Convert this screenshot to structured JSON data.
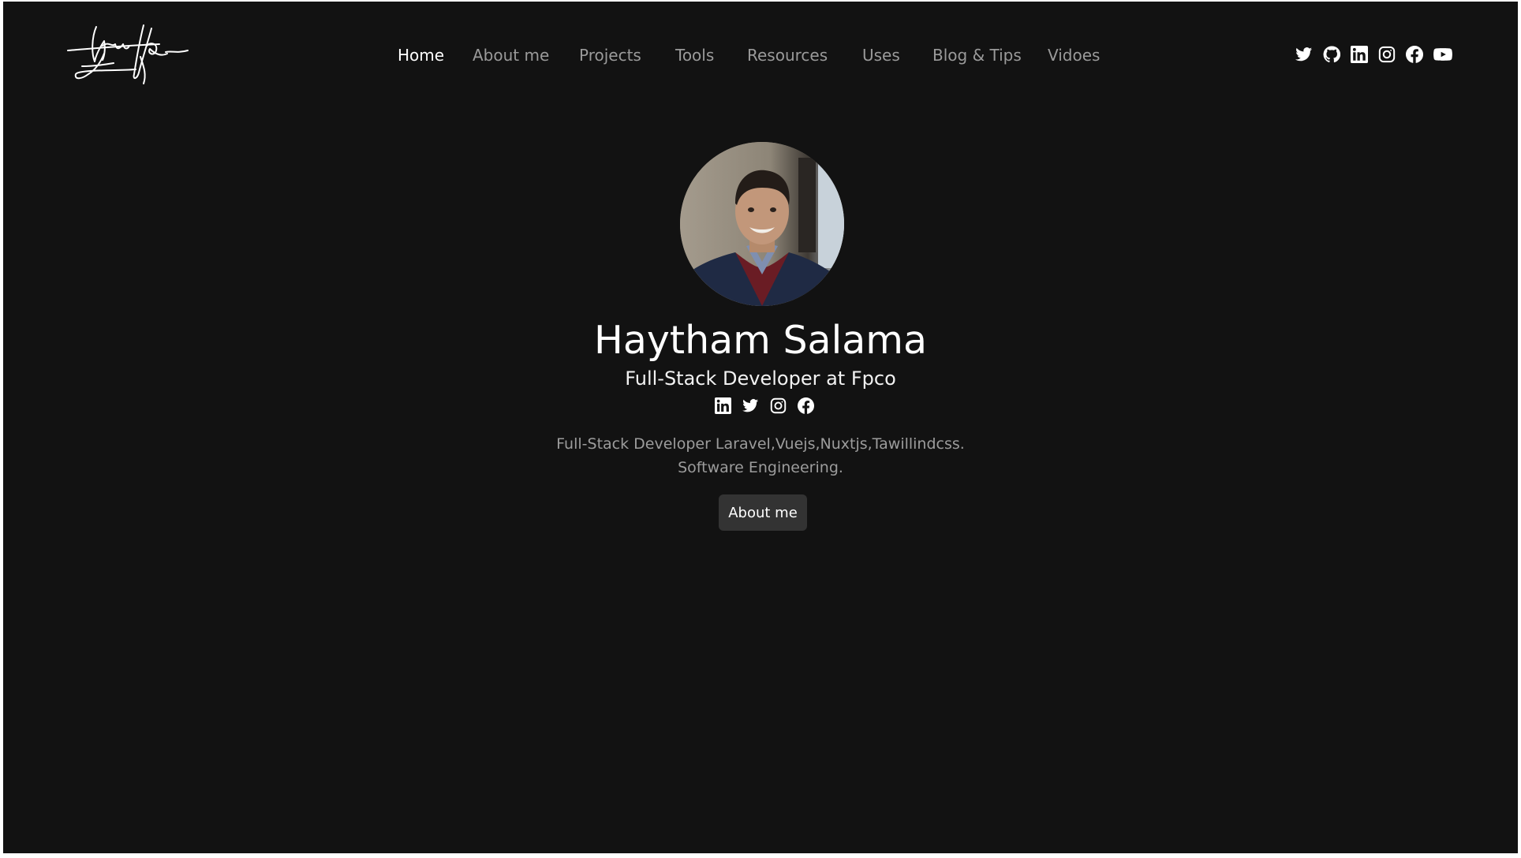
{
  "logo": {
    "alt": "Haytham signature"
  },
  "nav": {
    "items": [
      {
        "label": "Home",
        "active": true
      },
      {
        "label": "About me",
        "active": false
      },
      {
        "label": "Projects",
        "active": false
      },
      {
        "label": "Tools",
        "active": false
      },
      {
        "label": "Resources",
        "active": false
      },
      {
        "label": "Uses",
        "active": false
      },
      {
        "label": "Blog & Tips",
        "active": false
      },
      {
        "label": "Vidoes",
        "active": false
      }
    ],
    "social_icons": [
      "twitter-icon",
      "github-icon",
      "linkedin-icon",
      "instagram-icon",
      "facebook-icon",
      "youtube-icon"
    ]
  },
  "hero": {
    "name": "Haytham Salama",
    "role": "Full-Stack Developer at Fpco",
    "social_icons": [
      "linkedin-icon",
      "twitter-icon",
      "instagram-icon",
      "facebook-icon"
    ],
    "bio_line_1": "Full-Stack Developer Laravel,Vuejs,Nuxtjs,Tawillindcss.",
    "bio_line_2": "Software Engineering.",
    "button_label": "About me"
  },
  "colors": {
    "background": "#121212",
    "text_primary": "#ffffff",
    "text_muted": "#9a9a9a",
    "button_bg": "#333333"
  }
}
